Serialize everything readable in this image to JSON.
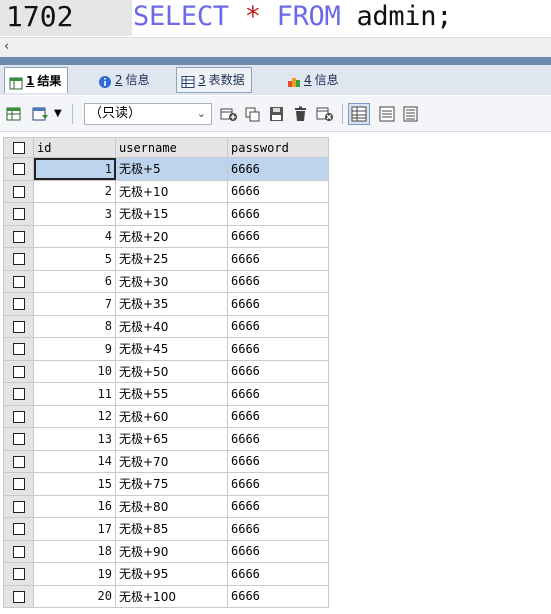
{
  "editor": {
    "line_number": "1702",
    "sql_kw_select": "SELECT",
    "sql_star": "*",
    "sql_kw_from": "FROM",
    "sql_table": "admin;"
  },
  "scrollbar": {
    "left_arrow": "‹"
  },
  "tabs": [
    {
      "num": "1",
      "label": "结果",
      "active": true,
      "icon": "result-grid-icon"
    },
    {
      "num": "2",
      "label": "信息",
      "icon": "info-icon"
    },
    {
      "num": "3",
      "label": "表数据",
      "icon": "table-data-icon"
    },
    {
      "num": "4",
      "label": "信息",
      "icon": "info-colored-icon"
    }
  ],
  "toolbar": {
    "mode_select_value": "（只读）",
    "chevron": "⌄"
  },
  "grid": {
    "columns": [
      "id",
      "username",
      "password"
    ],
    "rows": [
      {
        "id": "1",
        "username": "无极+5",
        "password": "6666"
      },
      {
        "id": "2",
        "username": "无极+10",
        "password": "6666"
      },
      {
        "id": "3",
        "username": "无极+15",
        "password": "6666"
      },
      {
        "id": "4",
        "username": "无极+20",
        "password": "6666"
      },
      {
        "id": "5",
        "username": "无极+25",
        "password": "6666"
      },
      {
        "id": "6",
        "username": "无极+30",
        "password": "6666"
      },
      {
        "id": "7",
        "username": "无极+35",
        "password": "6666"
      },
      {
        "id": "8",
        "username": "无极+40",
        "password": "6666"
      },
      {
        "id": "9",
        "username": "无极+45",
        "password": "6666"
      },
      {
        "id": "10",
        "username": "无极+50",
        "password": "6666"
      },
      {
        "id": "11",
        "username": "无极+55",
        "password": "6666"
      },
      {
        "id": "12",
        "username": "无极+60",
        "password": "6666"
      },
      {
        "id": "13",
        "username": "无极+65",
        "password": "6666"
      },
      {
        "id": "14",
        "username": "无极+70",
        "password": "6666"
      },
      {
        "id": "15",
        "username": "无极+75",
        "password": "6666"
      },
      {
        "id": "16",
        "username": "无极+80",
        "password": "6666"
      },
      {
        "id": "17",
        "username": "无极+85",
        "password": "6666"
      },
      {
        "id": "18",
        "username": "无极+90",
        "password": "6666"
      },
      {
        "id": "19",
        "username": "无极+95",
        "password": "6666"
      },
      {
        "id": "20",
        "username": "无极+100",
        "password": "6666"
      }
    ]
  }
}
